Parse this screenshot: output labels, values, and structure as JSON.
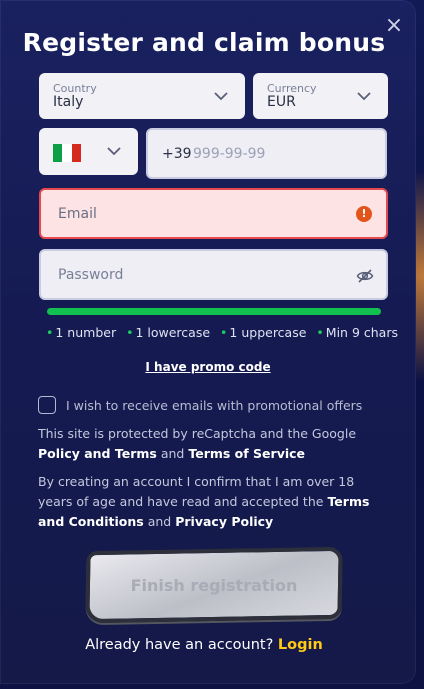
{
  "dialog": {
    "title": "Register and claim bonus",
    "close_label": "×"
  },
  "country": {
    "label": "Country",
    "value": "Italy"
  },
  "currency": {
    "label": "Currency",
    "value": "EUR"
  },
  "phone": {
    "code": "+39",
    "placeholder": "999-99-99",
    "flag_colors": [
      "#0d9f48",
      "#ffffff",
      "#d52b1e"
    ]
  },
  "email": {
    "placeholder": "Email",
    "error_icon": "!"
  },
  "password": {
    "placeholder": "Password",
    "icon": "eye-slash-icon"
  },
  "password_strength": {
    "fill": 1.0,
    "color": "#11c04f"
  },
  "password_rules": [
    "1 number",
    "1 lowercase",
    "1 uppercase",
    "Min 9 chars"
  ],
  "promo_link": "I have promo code",
  "marketing_optin": {
    "label": "I wish to receive emails with promotional offers",
    "checked": false
  },
  "recaptcha": {
    "text_1": "This site is protected by reCaptcha and the Google",
    "policy_terms": "Policy and Terms",
    "and": "and",
    "terms_of_service": "Terms of Service"
  },
  "consent": {
    "text_1": "By creating an account I confirm that I am over 18 years of age and have read and accepted the",
    "terms": "Terms and Conditions",
    "and": "and",
    "privacy": "Privacy Policy"
  },
  "submit_label": "Finish registration",
  "footer": {
    "question": "Already have an account?",
    "login": "Login"
  },
  "colors": {
    "accent": "#ffc915",
    "error": "#e54a4f",
    "modal_bg": "#171d55"
  }
}
